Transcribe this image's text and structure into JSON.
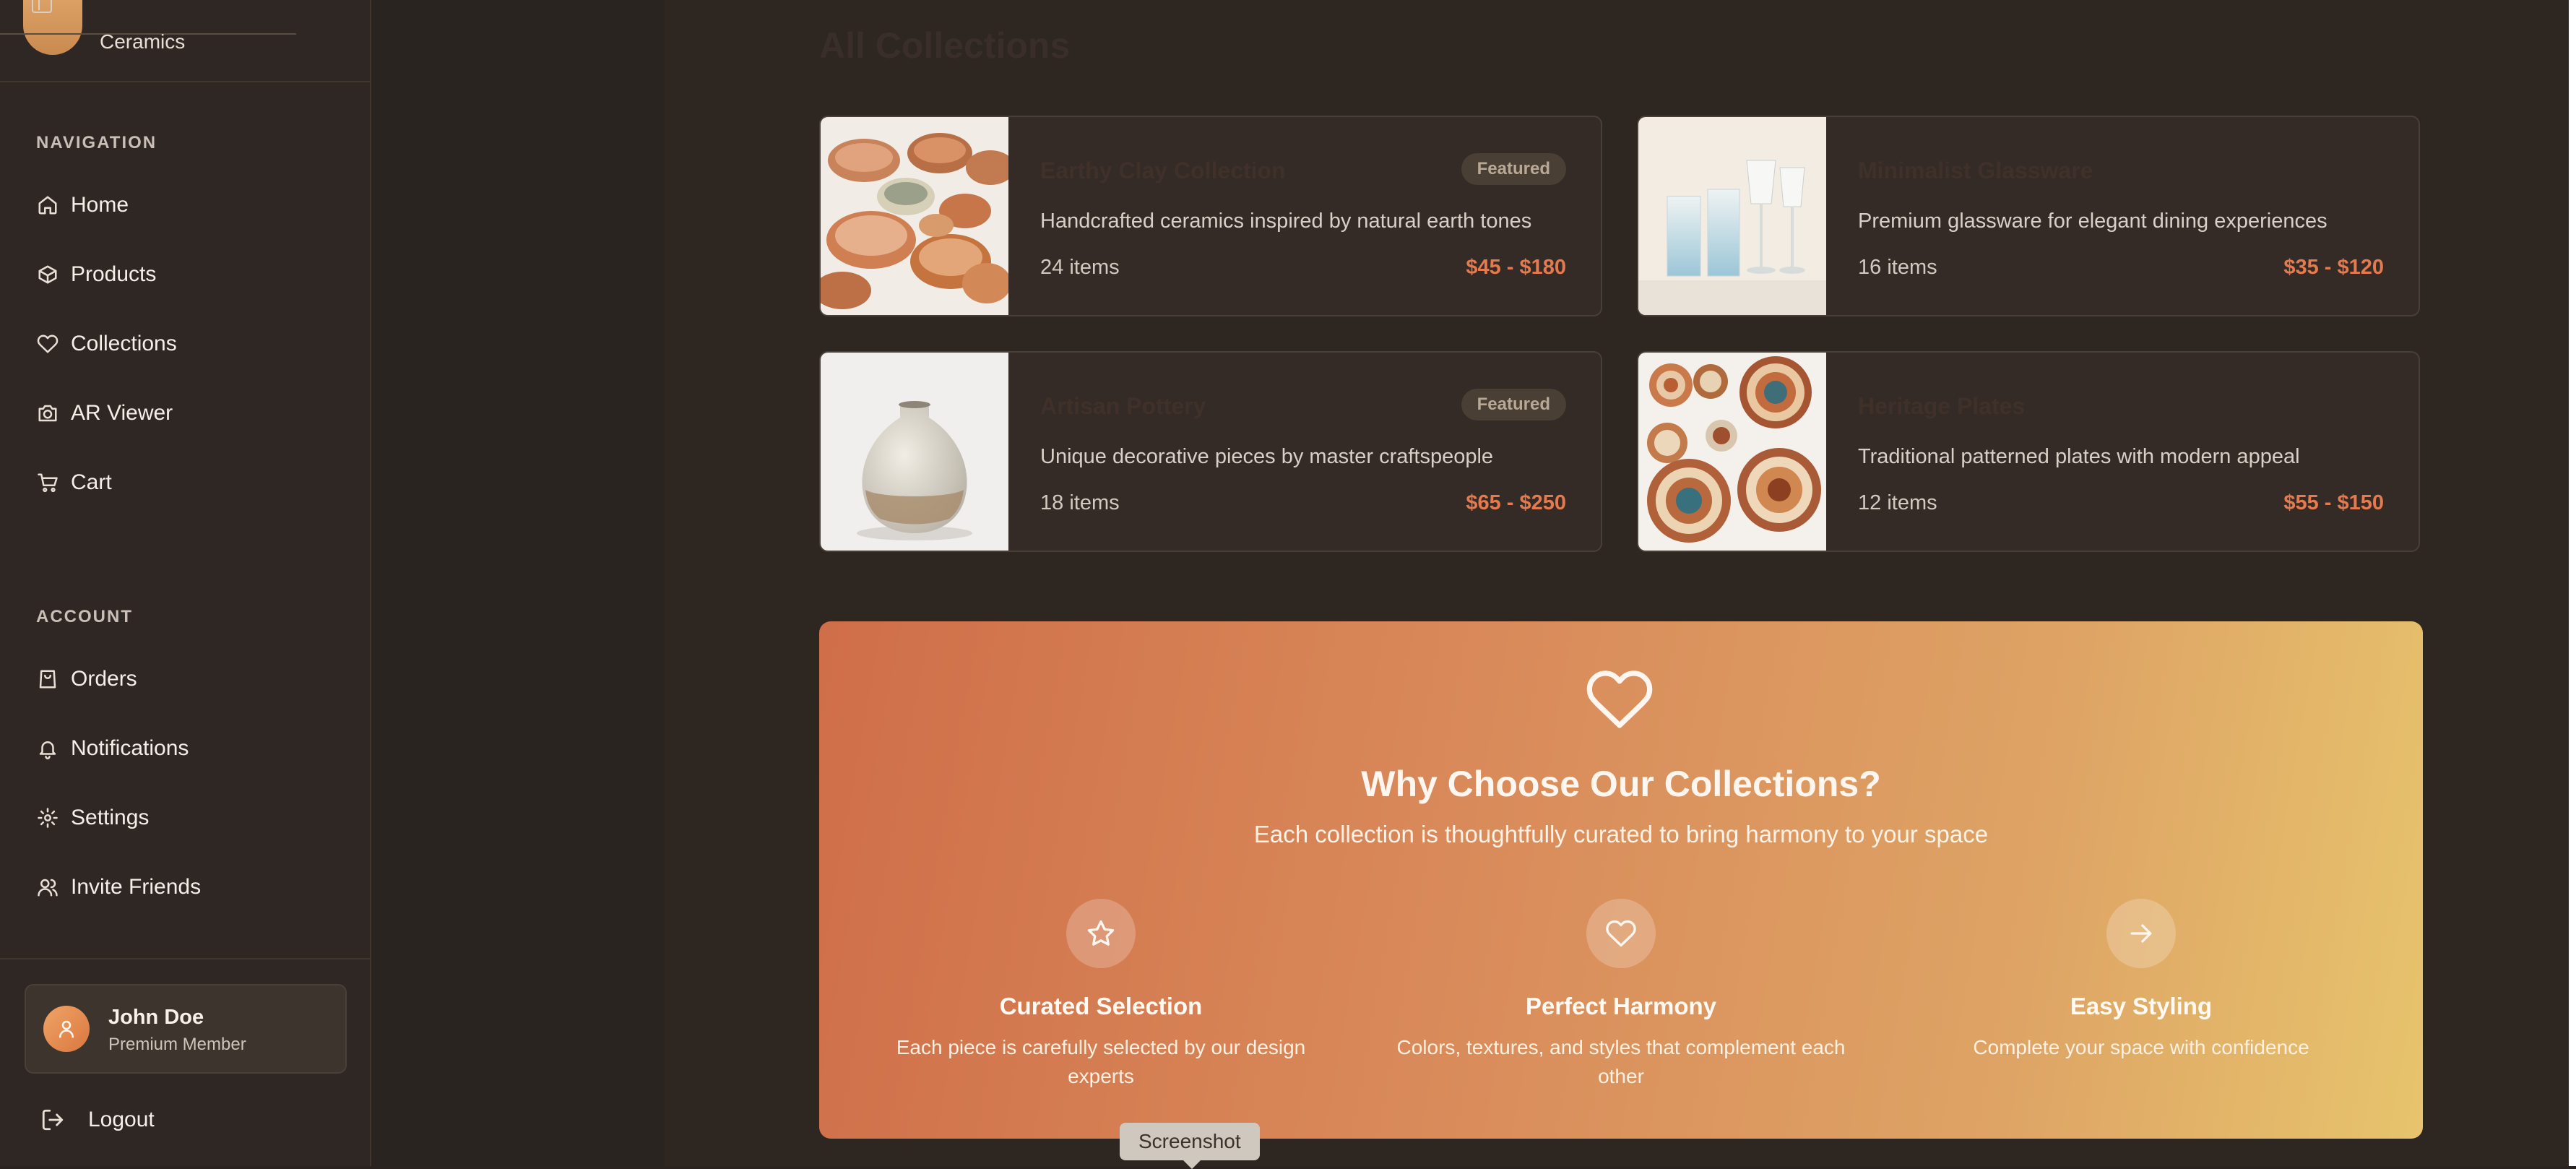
{
  "brand": {
    "subtitle": "Ceramics"
  },
  "sidebar": {
    "navigation_title": "NAVIGATION",
    "nav_items": [
      {
        "label": "Home",
        "icon": "home-icon"
      },
      {
        "label": "Products",
        "icon": "package-icon"
      },
      {
        "label": "Collections",
        "icon": "heart-icon"
      },
      {
        "label": "AR Viewer",
        "icon": "camera-icon"
      },
      {
        "label": "Cart",
        "icon": "cart-icon"
      }
    ],
    "account_title": "ACCOUNT",
    "account_items": [
      {
        "label": "Orders",
        "icon": "shopping-bag-icon"
      },
      {
        "label": "Notifications",
        "icon": "bell-icon"
      },
      {
        "label": "Settings",
        "icon": "gear-icon"
      },
      {
        "label": "Invite Friends",
        "icon": "users-icon"
      }
    ],
    "user": {
      "name": "John Doe",
      "role": "Premium Member"
    },
    "logout_label": "Logout"
  },
  "main": {
    "title": "All Collections",
    "collections": [
      {
        "name": "Earthy Clay Collection",
        "featured": true,
        "badge": "Featured",
        "description": "Handcrafted ceramics inspired by natural earth tones",
        "count": "24 items",
        "price": "$45 - $180"
      },
      {
        "name": "Minimalist Glassware",
        "featured": false,
        "badge": "",
        "description": "Premium glassware for elegant dining experiences",
        "count": "16 items",
        "price": "$35 - $120"
      },
      {
        "name": "Artisan Pottery",
        "featured": true,
        "badge": "Featured",
        "description": "Unique decorative pieces by master craftspeople",
        "count": "18 items",
        "price": "$65 - $250"
      },
      {
        "name": "Heritage Plates",
        "featured": false,
        "badge": "",
        "description": "Traditional patterned plates with modern appeal",
        "count": "12 items",
        "price": "$55 - $150"
      }
    ],
    "why": {
      "title": "Why Choose Our Collections?",
      "subtitle": "Each collection is thoughtfully curated to bring harmony to your space",
      "features": [
        {
          "title": "Curated Selection",
          "description": "Each piece is carefully selected by our design experts",
          "icon": "star-icon"
        },
        {
          "title": "Perfect Harmony",
          "description": "Colors, textures, and styles that complement each other",
          "icon": "heart-icon"
        },
        {
          "title": "Easy Styling",
          "description": "Complete your space with confidence",
          "icon": "arrow-right-icon"
        }
      ]
    }
  },
  "tooltip": "Screenshot",
  "colors": {
    "accent": "#e47a4e",
    "sidebar_bg": "#2f2723",
    "main_bg": "#2d2621",
    "gradient_start": "#cf6e49",
    "gradient_end": "#e7c46d"
  }
}
